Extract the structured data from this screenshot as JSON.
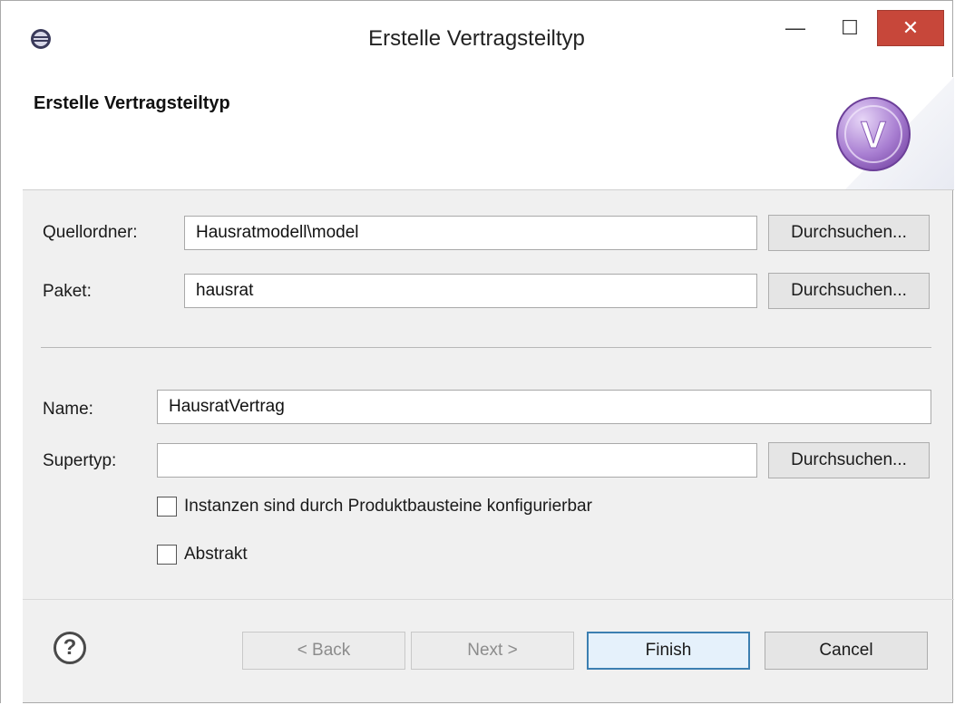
{
  "window": {
    "title": "Erstelle Vertragsteiltyp",
    "minimize_glyph": "—",
    "maximize_glyph": "☐",
    "close_glyph": "✕"
  },
  "header": {
    "title": "Erstelle Vertragsteiltyp",
    "logo_letter": "V"
  },
  "form": {
    "source_folder": {
      "label": "Quellordner:",
      "value": "Hausratmodell\\model",
      "browse_label": "Durchsuchen..."
    },
    "package": {
      "label": "Paket:",
      "value": "hausrat",
      "browse_label": "Durchsuchen..."
    },
    "name": {
      "label": "Name:",
      "value": "HausratVertrag"
    },
    "supertype": {
      "label": "Supertyp:",
      "value": "",
      "browse_label": "Durchsuchen..."
    },
    "configurable_checkbox": {
      "label": "Instanzen sind durch Produktbausteine konfigurierbar",
      "checked": false
    },
    "abstract_checkbox": {
      "label": "Abstrakt",
      "checked": false
    }
  },
  "buttons": {
    "help": "?",
    "back": "< Back",
    "next": "Next >",
    "finish": "Finish",
    "cancel": "Cancel"
  },
  "colors": {
    "close_button": "#c7473a",
    "logo_purple": "#9b6cc4",
    "finish_border": "#3c7fb1"
  }
}
